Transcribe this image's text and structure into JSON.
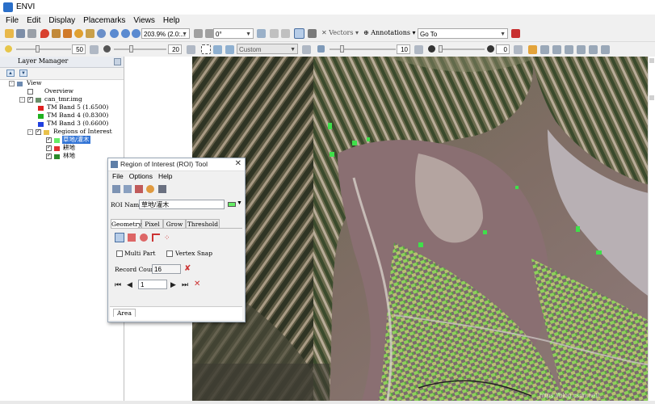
{
  "window": {
    "title": "ENVI"
  },
  "menubar": [
    "File",
    "Edit",
    "Display",
    "Placemarks",
    "Views",
    "Help"
  ],
  "toolbar1": {
    "zoom_value": "203.9% (2.0:...",
    "rotation_value": "0°",
    "vectors_label": "Vectors",
    "annotations_label": "Annotations",
    "goto_placeholder": "Go To"
  },
  "toolbar2": {
    "brightness_value": "50",
    "contrast_value": "20",
    "stretch_value": "Custom",
    "sharpen_value": "10",
    "transparency_value": "0"
  },
  "layer_manager": {
    "title": "Layer Manager",
    "tree": [
      {
        "label": "View"
      },
      {
        "label": "Overview"
      },
      {
        "label": "can_tmr.img"
      },
      {
        "label": "TM Band 5 (1.6500)",
        "color": "#e02020"
      },
      {
        "label": "TM Band 4 (0.8300)",
        "color": "#20b020"
      },
      {
        "label": "TM Band 3 (0.6600)",
        "color": "#2040e0"
      },
      {
        "label": "Regions of Interest"
      },
      {
        "label": "草地/灌木",
        "color": "#66ee66"
      },
      {
        "label": "耕地",
        "color": "#e03030"
      },
      {
        "label": "林地",
        "color": "#2a8a2a"
      }
    ]
  },
  "roi_tool": {
    "title": "Region of Interest (ROI) Tool",
    "menu": [
      "File",
      "Options",
      "Help"
    ],
    "roi_name_label": "ROI Name",
    "roi_name_value": "草地/灌木",
    "roi_color": "#66ee66",
    "tabs": [
      "Geometry",
      "Pixel",
      "Grow",
      "Threshold"
    ],
    "multi_part_label": "Multi Part",
    "vertex_snap_label": "Vertex Snap",
    "record_count_label": "Record Count",
    "record_count_value": "16",
    "record_index_value": "1",
    "bottom_tab": "Area"
  },
  "watermark": "https://blog.csdn.net/..."
}
